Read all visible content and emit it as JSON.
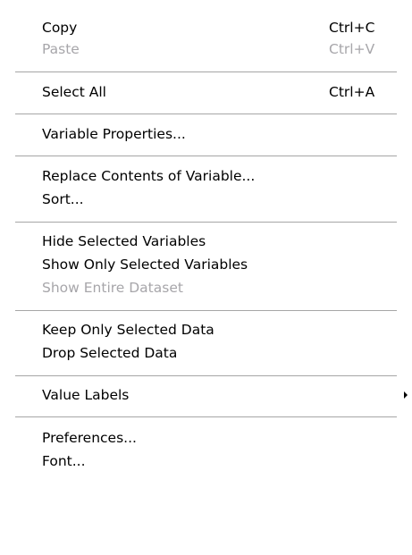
{
  "context_menu": {
    "copy": {
      "label": "Copy",
      "shortcut": "Ctrl+C"
    },
    "paste": {
      "label": "Paste",
      "shortcut": "Ctrl+V"
    },
    "select_all": {
      "label": "Select All",
      "shortcut": "Ctrl+A"
    },
    "variable_properties": {
      "label": "Variable Properties..."
    },
    "replace_contents": {
      "label": "Replace Contents of Variable..."
    },
    "sort": {
      "label": "Sort..."
    },
    "hide_selected": {
      "label": "Hide Selected Variables"
    },
    "show_only_selected": {
      "label": "Show Only Selected Variables"
    },
    "show_entire": {
      "label": "Show Entire Dataset"
    },
    "keep_only_selected": {
      "label": "Keep Only Selected Data"
    },
    "drop_selected": {
      "label": "Drop Selected Data"
    },
    "value_labels": {
      "label": "Value Labels",
      "icon": "submenu-arrow-icon"
    },
    "preferences": {
      "label": "Preferences..."
    },
    "font": {
      "label": "Font..."
    }
  },
  "colors": {
    "background": "#ffffff",
    "text": "#000000",
    "disabled_text": "#a7a6aa",
    "separator": "#a6a6a6"
  }
}
